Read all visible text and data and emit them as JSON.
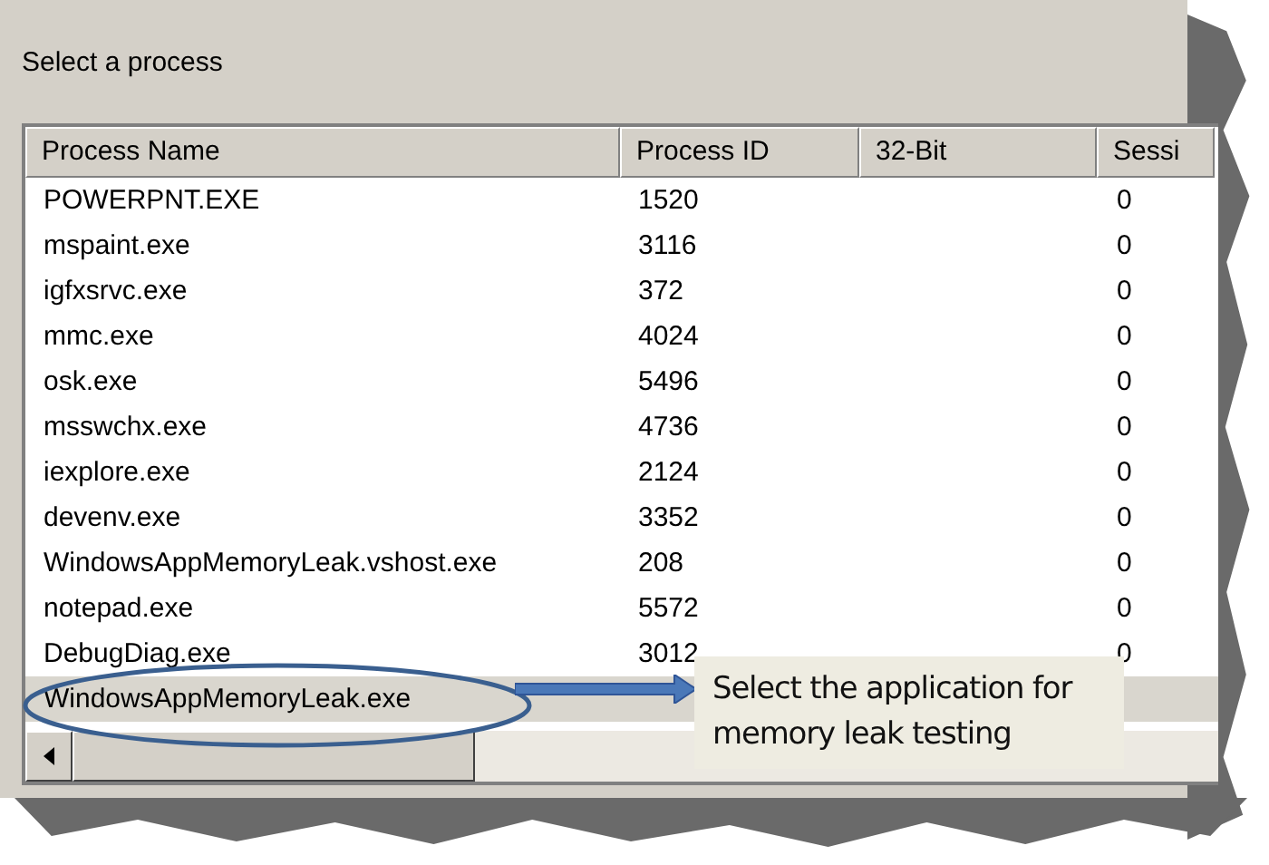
{
  "dialog": {
    "heading": "Select a process"
  },
  "table": {
    "columns": [
      "Process Name",
      "Process ID",
      "32-Bit",
      "Sessi"
    ],
    "rows": [
      {
        "name": "POWERPNT.EXE",
        "pid": "1520",
        "session": "0",
        "selected": false
      },
      {
        "name": "mspaint.exe",
        "pid": "3116",
        "session": "0",
        "selected": false
      },
      {
        "name": "igfxsrvc.exe",
        "pid": "372",
        "session": "0",
        "selected": false
      },
      {
        "name": "mmc.exe",
        "pid": "4024",
        "session": "0",
        "selected": false
      },
      {
        "name": "osk.exe",
        "pid": "5496",
        "session": "0",
        "selected": false
      },
      {
        "name": "msswchx.exe",
        "pid": "4736",
        "session": "0",
        "selected": false
      },
      {
        "name": "iexplore.exe",
        "pid": "2124",
        "session": "0",
        "selected": false
      },
      {
        "name": "devenv.exe",
        "pid": "3352",
        "session": "0",
        "selected": false
      },
      {
        "name": "WindowsAppMemoryLeak.vshost.exe",
        "pid": "208",
        "session": "0",
        "selected": false
      },
      {
        "name": "notepad.exe",
        "pid": "5572",
        "session": "0",
        "selected": false
      },
      {
        "name": "DebugDiag.exe",
        "pid": "3012",
        "session": "0",
        "selected": false
      },
      {
        "name": "WindowsAppMemoryLeak.exe",
        "selected": true
      }
    ]
  },
  "callout": {
    "text": "Select the application for memory leak testing"
  }
}
